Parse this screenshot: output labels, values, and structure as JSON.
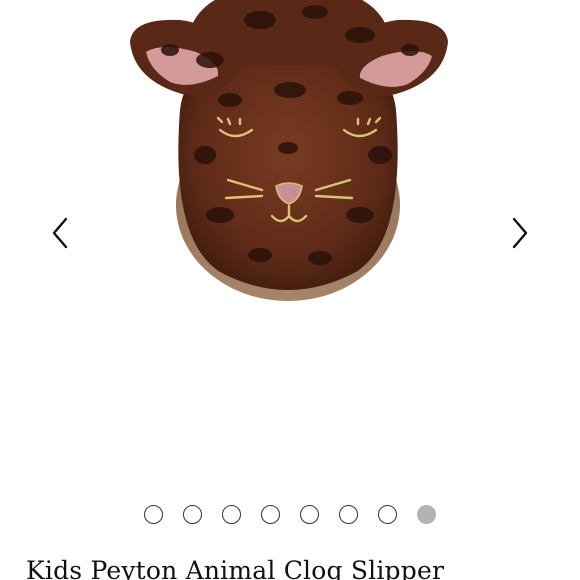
{
  "product": {
    "title": "Kids Peyton Animal Clog Slipper"
  },
  "gallery": {
    "image_subject": "leopard-print-slipper-with-cat-face",
    "prev_icon": "chevron-left-icon",
    "next_icon": "chevron-right-icon",
    "total_images": 8,
    "active_index": 8
  },
  "colors": {
    "dot_border": "#333333",
    "dot_active": "#b3b3b3",
    "title_text": "#111111"
  }
}
